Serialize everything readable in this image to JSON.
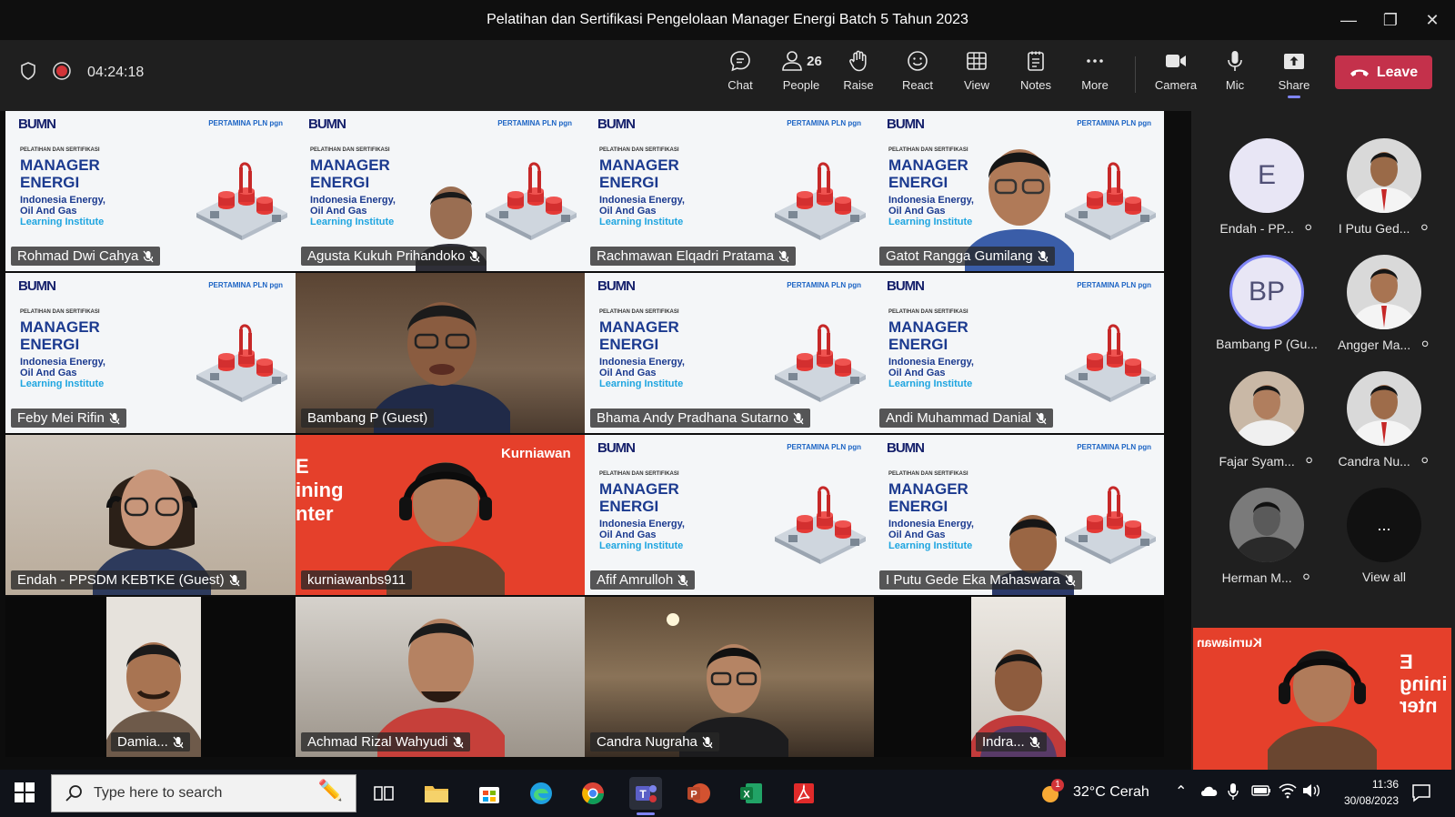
{
  "window": {
    "title": "Pelatihan dan Sertifikasi Pengelolaan Manager Energi Batch 5 Tahun 2023"
  },
  "meeting": {
    "timer": "04:24:18"
  },
  "toolbar": {
    "chat": "Chat",
    "people": "People",
    "people_count": "26",
    "raise": "Raise",
    "react": "React",
    "view": "View",
    "notes": "Notes",
    "more": "More",
    "camera": "Camera",
    "mic": "Mic",
    "share": "Share",
    "leave": "Leave"
  },
  "slide": {
    "logo": "BUMN",
    "sponsors": "PERTAMINA  PLN  pgn",
    "small_caption": "PELATIHAN DAN SERTIFIKASI",
    "heading_line1": "MANAGER",
    "heading_line2": "ENERGI",
    "sub_line1": "Indonesia Energy,",
    "sub_line2": "Oil And Gas",
    "sub_line3": "Learning Institute"
  },
  "tiles": [
    {
      "name": "Rohmad Dwi Cahya"
    },
    {
      "name": "Agusta Kukuh Prihandoko"
    },
    {
      "name": "Rachmawan Elqadri Pratama"
    },
    {
      "name": "Gatot Rangga Gumilang"
    },
    {
      "name": "Feby Mei Rifin"
    },
    {
      "name": "Bambang P (Guest)"
    },
    {
      "name": "Bhama Andy Pradhana Sutarno"
    },
    {
      "name": "Andi Muhammad Danial"
    },
    {
      "name": "Endah - PPSDM KEBTKE (Guest)"
    },
    {
      "name": "kurniawanbs911"
    },
    {
      "name": "Afif Amrulloh"
    },
    {
      "name": "I Putu Gede Eka Mahaswara"
    },
    {
      "name": "Damia..."
    },
    {
      "name": "Achmad Rizal Wahyudi"
    },
    {
      "name": "Candra Nugraha"
    },
    {
      "name": "Indra..."
    }
  ],
  "kurniawan_bg_text": {
    "top": "Kurniawan",
    "l1": "E",
    "l2": "ining",
    "l3": "nter"
  },
  "rail": [
    {
      "name": "Endah - PP...",
      "initials": "E"
    },
    {
      "name": "I Putu Ged...",
      "initials": ""
    },
    {
      "name": "Bambang P (Gu...",
      "initials": "BP"
    },
    {
      "name": "Angger Ma...",
      "initials": ""
    },
    {
      "name": "Fajar Syam...",
      "initials": ""
    },
    {
      "name": "Candra Nu...",
      "initials": ""
    },
    {
      "name": "Herman M...",
      "initials": ""
    },
    {
      "name": "View all",
      "initials": "..."
    }
  ],
  "taskbar": {
    "search_placeholder": "Type here to search",
    "weather": "32°C  Cerah",
    "time": "11:36",
    "date": "30/08/2023",
    "weather_badge": "1"
  },
  "colors": {
    "leave": "#c4314b",
    "accent": "#7f85f5",
    "slide_heading": "#1b3a8f"
  }
}
